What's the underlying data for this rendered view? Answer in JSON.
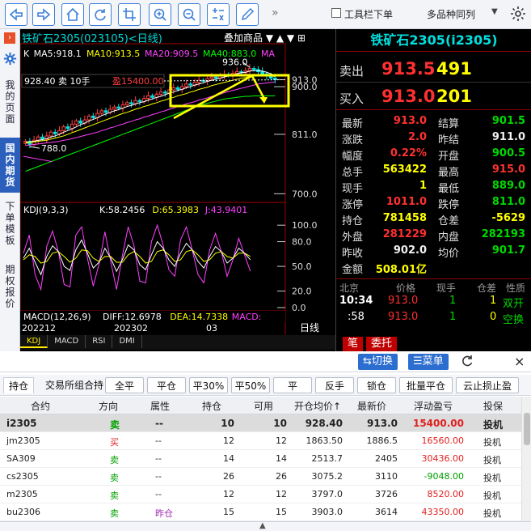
{
  "toolbar": {
    "more": "»",
    "checkbox_label": "工具栏下单",
    "multi_label": "多品种同列",
    "multi_arrow": "▼",
    "colors": {
      "accent": "#3b7fd8"
    }
  },
  "sidebar": {
    "items": [
      {
        "label": "我的页面"
      },
      {
        "label": "国内期货"
      },
      {
        "label": "下单模板"
      },
      {
        "label": "期权报价"
      }
    ]
  },
  "chart": {
    "title": "铁矿石2305(023105)<日线)",
    "overlay_label": "叠加商品",
    "ma_line": [
      {
        "text": "K",
        "color": "#ffffff"
      },
      {
        "text": "MA5:918.1",
        "color": "#ffffff"
      },
      {
        "text": "MA10:913.5",
        "color": "#ffff00"
      },
      {
        "text": "MA20:909.5",
        "color": "#ff40ff"
      },
      {
        "text": "MA40:883.0",
        "color": "#00ff00"
      },
      {
        "text": "MA",
        "color": "#ff40ff"
      }
    ],
    "position_label": "928.40  卖  10手",
    "position_profit": "盈15400.00",
    "marker_high": "936.0",
    "marker_low": "788.0",
    "price_ticks": [
      "913.0",
      "900.0",
      "811.0",
      "700.0"
    ],
    "kdj_label": "KDJ(9,3,3)",
    "kdj_values": [
      {
        "text": "K:58.2456",
        "color": "#ffffff"
      },
      {
        "text": "D:65.3983",
        "color": "#ffff00"
      },
      {
        "text": "J:43.9401",
        "color": "#ff40ff"
      }
    ],
    "kdj_ticks": [
      "100.0",
      "80.0",
      "50.0",
      "20.0",
      "0.0"
    ],
    "macd_label": "MACD(12,26,9)",
    "macd_values": [
      {
        "text": "DIFF:12.6978",
        "color": "#ffffff"
      },
      {
        "text": "DEA:14.7338",
        "color": "#ffff00"
      },
      {
        "text": "MACD:",
        "color": "#ff40ff"
      }
    ],
    "dates": [
      "202212",
      "202302",
      "03"
    ],
    "period": "日线",
    "tabs": [
      "KDJ",
      "MACD",
      "RSI",
      "DMI"
    ]
  },
  "chart_data": {
    "type": "candlestick",
    "title": "铁矿石2305(023105)<日线)",
    "series": [
      {
        "name": "K",
        "values": [
          798,
          792,
          800,
          806,
          802,
          808,
          815,
          812,
          818,
          825,
          822,
          830,
          836,
          832,
          838,
          845,
          842,
          850,
          855,
          852,
          858,
          862,
          860,
          866,
          870,
          868,
          874,
          872,
          878,
          883,
          880,
          886,
          890,
          888,
          894,
          898,
          895,
          900,
          905,
          903,
          908,
          912,
          910,
          915,
          918,
          916,
          920,
          923,
          921,
          925,
          928,
          926,
          930,
          934,
          932,
          928,
          924,
          920,
          916,
          913
        ]
      },
      {
        "name": "MA5",
        "values": [
          796,
          797,
          798,
          800,
          801,
          803,
          806,
          808,
          811,
          815,
          818,
          821,
          825,
          829,
          832,
          836,
          839,
          842,
          846,
          849,
          852,
          855,
          857,
          860,
          863,
          865,
          868,
          870,
          872,
          875,
          877,
          880,
          882,
          885,
          888,
          890,
          893,
          895,
          898,
          900,
          903,
          905,
          907,
          910,
          912,
          914,
          916,
          918,
          920,
          922,
          924,
          926,
          927,
          929,
          930,
          930,
          929,
          927,
          924,
          921
        ]
      },
      {
        "name": "MA10",
        "values": [
          795,
          796,
          797,
          798,
          799,
          800,
          802,
          804,
          806,
          808,
          811,
          814,
          817,
          820,
          823,
          826,
          829,
          832,
          835,
          838,
          841,
          844,
          847,
          850,
          852,
          855,
          858,
          860,
          863,
          865,
          868,
          870,
          873,
          875,
          878,
          880,
          883,
          885,
          887,
          890,
          892,
          895,
          897,
          899,
          902,
          904,
          906,
          908,
          910,
          912,
          914,
          916,
          917,
          919,
          920,
          921,
          921,
          921,
          920,
          919
        ]
      },
      {
        "name": "MA20",
        "values": [
          790,
          791,
          792,
          793,
          794,
          795,
          796,
          797,
          798,
          800,
          801,
          803,
          805,
          807,
          809,
          811,
          813,
          815,
          818,
          820,
          823,
          825,
          828,
          830,
          833,
          835,
          838,
          840,
          843,
          845,
          848,
          850,
          853,
          855,
          858,
          860,
          863,
          865,
          868,
          870,
          872,
          875,
          877,
          879,
          882,
          884,
          886,
          889,
          891,
          893,
          895,
          897,
          899,
          901,
          903,
          905,
          906,
          907,
          908,
          909
        ]
      },
      {
        "name": "MA40",
        "values": [
          742,
          745,
          748,
          751,
          754,
          757,
          760,
          763,
          766,
          769,
          772,
          775,
          778,
          781,
          784,
          787,
          790,
          793,
          796,
          799,
          802,
          805,
          808,
          811,
          814,
          817,
          820,
          823,
          826,
          829,
          832,
          835,
          838,
          841,
          844,
          847,
          850,
          853,
          856,
          859,
          862,
          865,
          867,
          869,
          871,
          873,
          875,
          877,
          878,
          879,
          880,
          881,
          882,
          882,
          883,
          883,
          883,
          883,
          883,
          883
        ]
      }
    ],
    "ylim": [
      690,
      950
    ],
    "kdj": {
      "K": [
        60,
        72,
        55,
        40,
        62,
        75,
        68,
        50,
        45,
        70,
        82,
        66,
        48,
        55,
        72,
        60,
        44,
        58,
        76,
        70,
        52,
        46,
        64,
        80,
        72,
        58,
        50,
        66,
        78,
        70,
        56,
        48,
        62,
        74,
        68,
        54,
        60,
        72,
        66,
        58
      ],
      "D": [
        58,
        64,
        62,
        54,
        56,
        66,
        68,
        62,
        55,
        60,
        70,
        69,
        60,
        56,
        62,
        62,
        55,
        55,
        64,
        68,
        62,
        54,
        56,
        68,
        70,
        64,
        56,
        58,
        68,
        70,
        64,
        56,
        58,
        66,
        68,
        62,
        60,
        66,
        66,
        62
      ],
      "J": [
        66,
        88,
        40,
        22,
        74,
        93,
        68,
        28,
        25,
        88,
        98,
        60,
        26,
        53,
        92,
        56,
        22,
        63,
        98,
        75,
        32,
        30,
        80,
        100,
        76,
        46,
        38,
        82,
        98,
        70,
        40,
        30,
        70,
        90,
        68,
        38,
        58,
        84,
        64,
        44
      ]
    },
    "kdj_ylim": [
      0,
      110
    ]
  },
  "quote": {
    "title": "铁矿石2305(i2305)",
    "sell": {
      "label": "卖出",
      "price": "913.5",
      "vol": "491"
    },
    "buy": {
      "label": "买入",
      "price": "913.0",
      "vol": "201"
    },
    "rows": [
      {
        "l1": "最新",
        "v1": "913.0",
        "c1": "red",
        "l2": "结算",
        "v2": "901.5",
        "c2": "green"
      },
      {
        "l1": "涨跌",
        "v1": "2.0",
        "c1": "red",
        "l2": "昨结",
        "v2": "911.0",
        "c2": "white"
      },
      {
        "l1": "幅度",
        "v1": "0.22%",
        "c1": "red",
        "l2": "开盘",
        "v2": "900.5",
        "c2": "green"
      },
      {
        "l1": "总手",
        "v1": "563422",
        "c1": "yellow",
        "l2": "最高",
        "v2": "915.0",
        "c2": "red"
      },
      {
        "l1": "现手",
        "v1": "1",
        "c1": "yellow",
        "l2": "最低",
        "v2": "889.0",
        "c2": "green"
      },
      {
        "l1": "涨停",
        "v1": "1011.0",
        "c1": "red",
        "l2": "跌停",
        "v2": "811.0",
        "c2": "green"
      },
      {
        "l1": "持仓",
        "v1": "781458",
        "c1": "yellow",
        "l2": "仓差",
        "v2": "-5629",
        "c2": "yellow"
      },
      {
        "l1": "外盘",
        "v1": "281229",
        "c1": "red",
        "l2": "内盘",
        "v2": "282193",
        "c2": "green"
      },
      {
        "l1": "昨收",
        "v1": "902.0",
        "c1": "white",
        "l2": "均价",
        "v2": "901.7",
        "c2": "green"
      },
      {
        "l1": "金额",
        "v1": "508.01亿",
        "c1": "yellow",
        "l2": "",
        "v2": "",
        "c2": "white"
      }
    ],
    "tick_head": [
      "北京",
      "价格",
      "现手",
      "仓差",
      "性质"
    ],
    "ticks": [
      {
        "time": "10:34",
        "price": "913.0",
        "vol": "1",
        "diff": "1",
        "nature": "双开"
      },
      {
        "time": ":58",
        "price": "913.0",
        "vol": "1",
        "diff": "0",
        "nature": "空换"
      }
    ],
    "bs_tabs": [
      "笔",
      "委托"
    ]
  },
  "bottom": {
    "switch_label": "⇆切换",
    "menu_label": "☰菜单",
    "close": "×",
    "tabs": [
      "持仓",
      "交易所组合持仓",
      "全平",
      "平仓",
      "平30%",
      "平50%",
      "平100%",
      "反手",
      "锁仓",
      "批量平仓",
      "云止损止盈"
    ],
    "columns": [
      "合约",
      "方向",
      "属性",
      "持仓",
      "可用",
      "开仓均价↑",
      "最新价",
      "浮动盈亏",
      "投保"
    ],
    "rows": [
      {
        "contract": "i2305",
        "dir": "卖",
        "attr": "--",
        "hold": "10",
        "avail": "10",
        "open": "928.40",
        "last": "913.0",
        "pnl": "15400.00",
        "type": "投机",
        "sel": true
      },
      {
        "contract": "jm2305",
        "dir": "买",
        "attr": "--",
        "hold": "12",
        "avail": "12",
        "open": "1863.50",
        "last": "1886.5",
        "pnl": "16560.00",
        "type": "投机",
        "sel": false
      },
      {
        "contract": "SA309",
        "dir": "卖",
        "attr": "--",
        "hold": "14",
        "avail": "14",
        "open": "2513.7",
        "last": "2405",
        "pnl": "30436.00",
        "type": "投机",
        "sel": false
      },
      {
        "contract": "cs2305",
        "dir": "卖",
        "attr": "--",
        "hold": "26",
        "avail": "26",
        "open": "3075.2",
        "last": "3110",
        "pnl": "-9048.00",
        "type": "投机",
        "sel": false
      },
      {
        "contract": "m2305",
        "dir": "卖",
        "attr": "--",
        "hold": "12",
        "avail": "12",
        "open": "3797.0",
        "last": "3726",
        "pnl": "8520.00",
        "type": "投机",
        "sel": false
      },
      {
        "contract": "bu2306",
        "dir": "卖",
        "attr": "昨仓",
        "hold": "15",
        "avail": "15",
        "open": "3903.0",
        "last": "3614",
        "pnl": "43350.00",
        "type": "投机",
        "sel": false
      }
    ]
  }
}
